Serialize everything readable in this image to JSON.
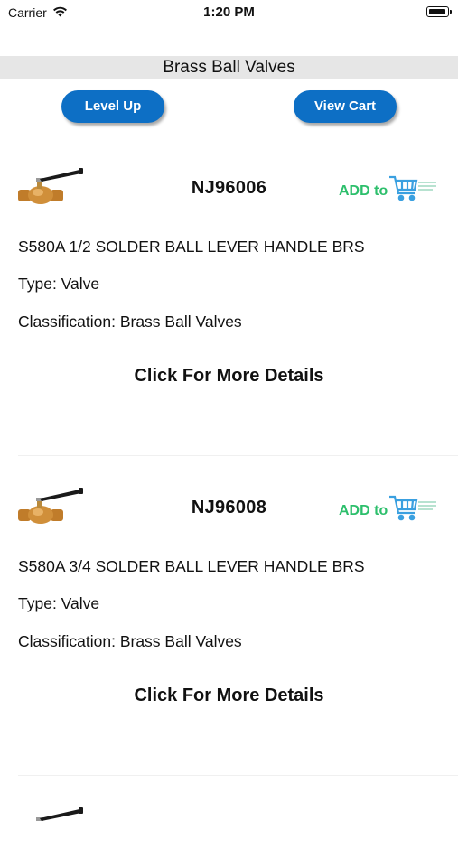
{
  "status_bar": {
    "carrier": "Carrier",
    "time": "1:20 PM",
    "icons": [
      "wifi-icon",
      "battery-icon"
    ]
  },
  "header": {
    "title": "Brass Ball Valves"
  },
  "buttons": {
    "level_up": "Level Up",
    "view_cart": "View Cart"
  },
  "products": [
    {
      "part_number": "NJ96006",
      "add_to_cart_text": "ADD to",
      "description": "S580A 1/2 SOLDER BALL LEVER HANDLE BRS",
      "type": "Type: Valve",
      "classification": "Classification: Brass Ball Valves",
      "details_link": "Click For More Details"
    },
    {
      "part_number": "NJ96008",
      "add_to_cart_text": "ADD to",
      "description": "S580A 3/4 SOLDER BALL LEVER HANDLE BRS",
      "type": "Type: Valve",
      "classification": "Classification: Brass Ball Valves",
      "details_link": "Click For More Details"
    }
  ],
  "colors": {
    "button_blue": "#0d6fc5",
    "title_bar_bg": "#e6e6e6",
    "add_cart_green": "#2dbf6c",
    "cart_blue": "#3aa0e0",
    "brass": "#c07c2a"
  }
}
